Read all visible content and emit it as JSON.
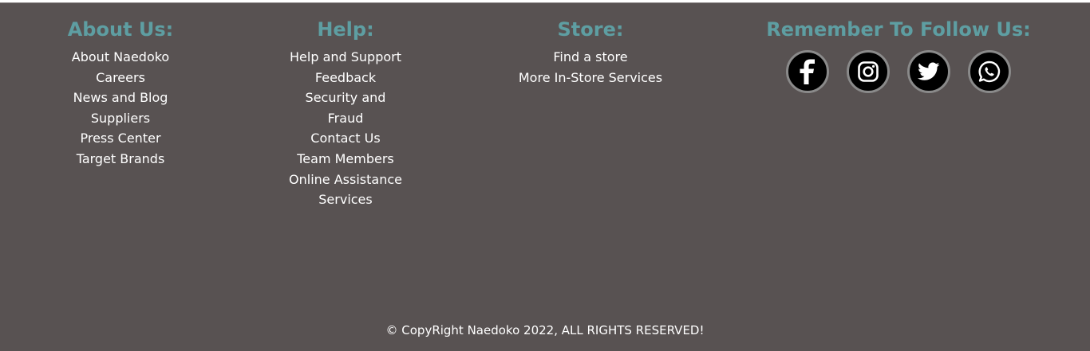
{
  "about": {
    "heading": "About Us:",
    "links": [
      "About Naedoko",
      "Careers",
      "News and Blog",
      "Suppliers",
      "Press Center",
      "Target Brands"
    ]
  },
  "help": {
    "heading": "Help:",
    "links": [
      "Help and Support",
      "Feedback",
      "Security and Fraud",
      "Contact Us",
      "Team Members",
      "Online Assistance Services"
    ]
  },
  "store": {
    "heading": "Store:",
    "links": [
      "Find a store",
      "More In-Store Services"
    ]
  },
  "follow": {
    "heading": "Remember To Follow Us:",
    "icons": [
      "facebook-icon",
      "instagram-icon",
      "twitter-icon",
      "whatsapp-icon"
    ]
  },
  "copyright": "© CopyRight Naedoko 2022, ALL RIGHTS RESERVED!",
  "colors": {
    "background": "#585252",
    "heading": "#5e9ea2",
    "text": "#ffffff"
  }
}
